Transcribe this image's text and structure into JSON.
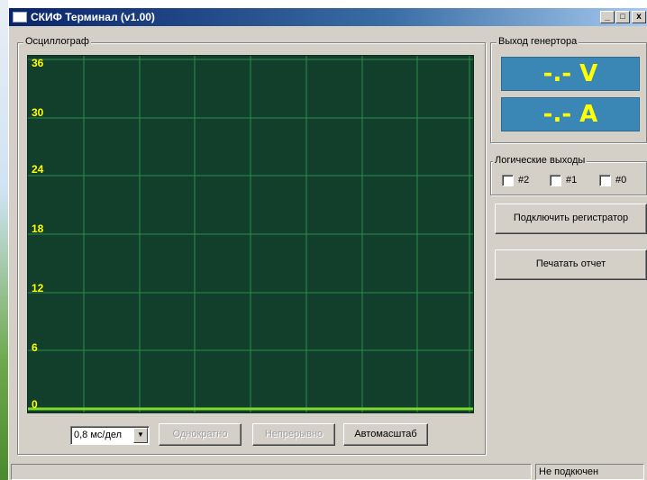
{
  "window": {
    "title": "СКИФ Терминал (v1.00)",
    "buttons": {
      "minimize": "_",
      "maximize": "□",
      "close": "x"
    }
  },
  "oscilloscope": {
    "group_label": "Осциллограф",
    "y_ticks": [
      "36",
      "30",
      "24",
      "18",
      "12",
      "6",
      "0"
    ],
    "colors": {
      "background": "#113f2c",
      "grid": "#2f8c4a",
      "baseline": "#7ddc2a",
      "tick_text": "#ffff00"
    },
    "timebase": {
      "selected": "0,8 мс/дел"
    },
    "buttons": {
      "single": "Однократно",
      "continuous": "Непрерывно",
      "autoscale": "Автомасштаб"
    }
  },
  "generator": {
    "group_label": "Выход генертора",
    "voltage": "-.- V",
    "current": "-.- A",
    "colors": {
      "display_bg": "#3a86b4",
      "display_text": "#ffff00"
    }
  },
  "logic_outputs": {
    "group_label": "Логические выходы",
    "items": [
      {
        "label": "#2",
        "checked": false
      },
      {
        "label": "#1",
        "checked": false
      },
      {
        "label": "#0",
        "checked": false
      }
    ]
  },
  "actions": {
    "connect_recorder": "Подключить регистратор",
    "print_report": "Печатать отчет"
  },
  "status": {
    "connection": "Не подкючен"
  }
}
